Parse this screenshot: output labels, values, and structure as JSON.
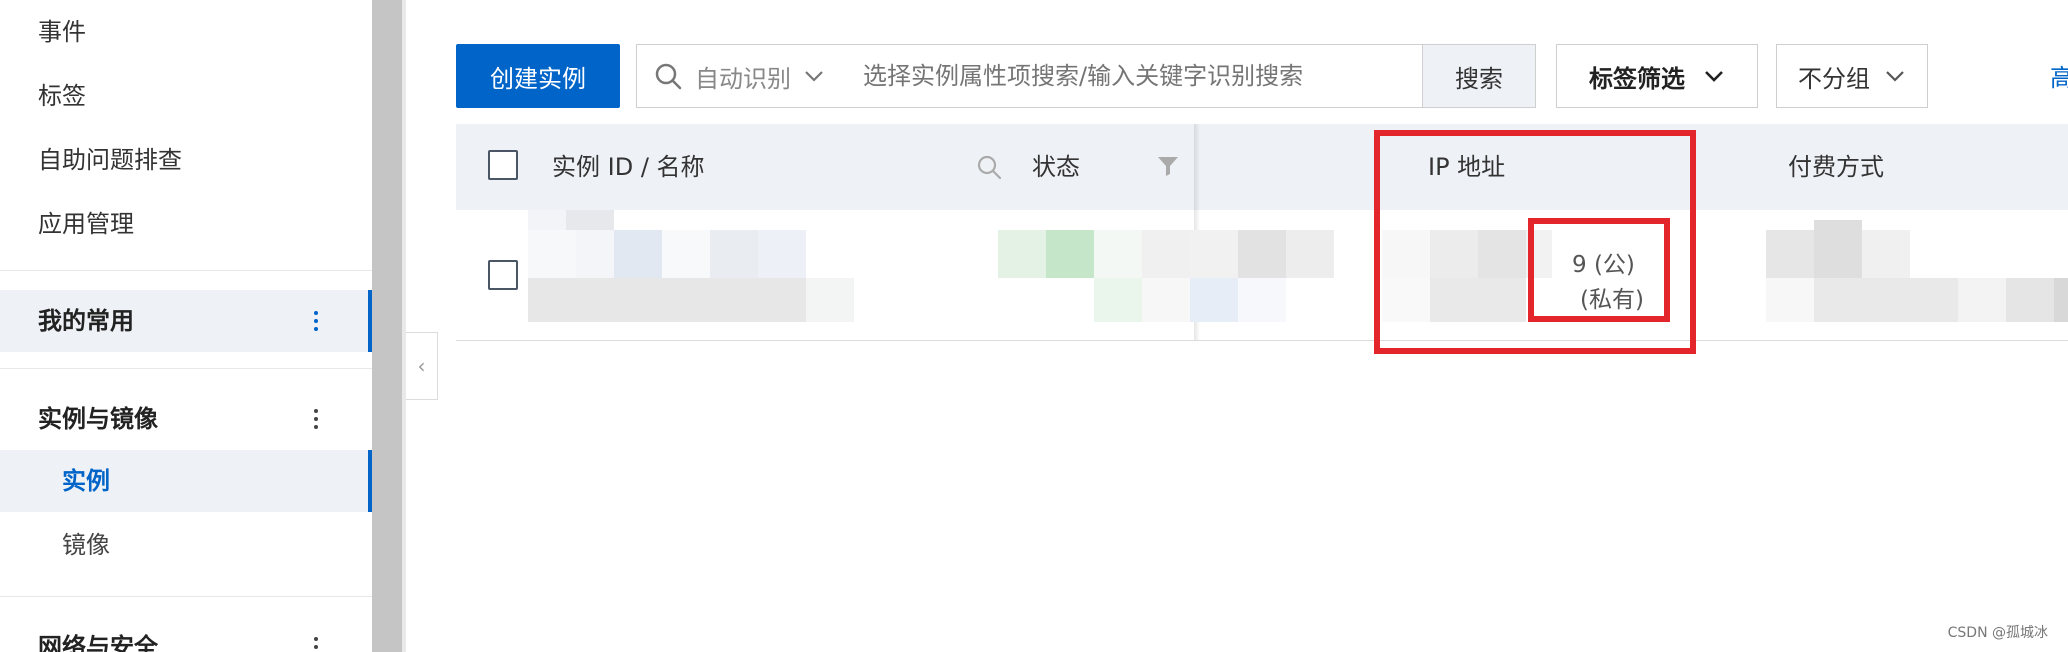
{
  "sidebar": {
    "items": [
      {
        "label": "事件"
      },
      {
        "label": "标签"
      },
      {
        "label": "自助问题排查"
      },
      {
        "label": "应用管理"
      }
    ],
    "groups": [
      {
        "label": "我的常用"
      },
      {
        "label": "实例与镜像"
      },
      {
        "label": "网络与安全"
      }
    ],
    "sub_items": [
      {
        "label": "实例",
        "active": true
      },
      {
        "label": "镜像",
        "active": false
      }
    ],
    "collapse_icon": "‹"
  },
  "toolbar": {
    "create_label": "创建实例",
    "auto_detect_label": "自动识别",
    "search_placeholder": "选择实例属性项搜索/输入关键字识别搜索",
    "search_button": "搜索",
    "tag_filter": "标签筛选",
    "group_select": "不分组",
    "advanced_link": "高"
  },
  "table": {
    "columns": [
      "实例 ID / 名称",
      "状态",
      "IP 地址",
      "付费方式"
    ],
    "row": {
      "ip_public": "9 (公)",
      "ip_private": "(私有)"
    }
  },
  "colors": {
    "primary": "#0064c8",
    "highlight_red": "#e3262b",
    "header_bg": "#eef1f6"
  },
  "watermark": "CSDN @孤城冰"
}
